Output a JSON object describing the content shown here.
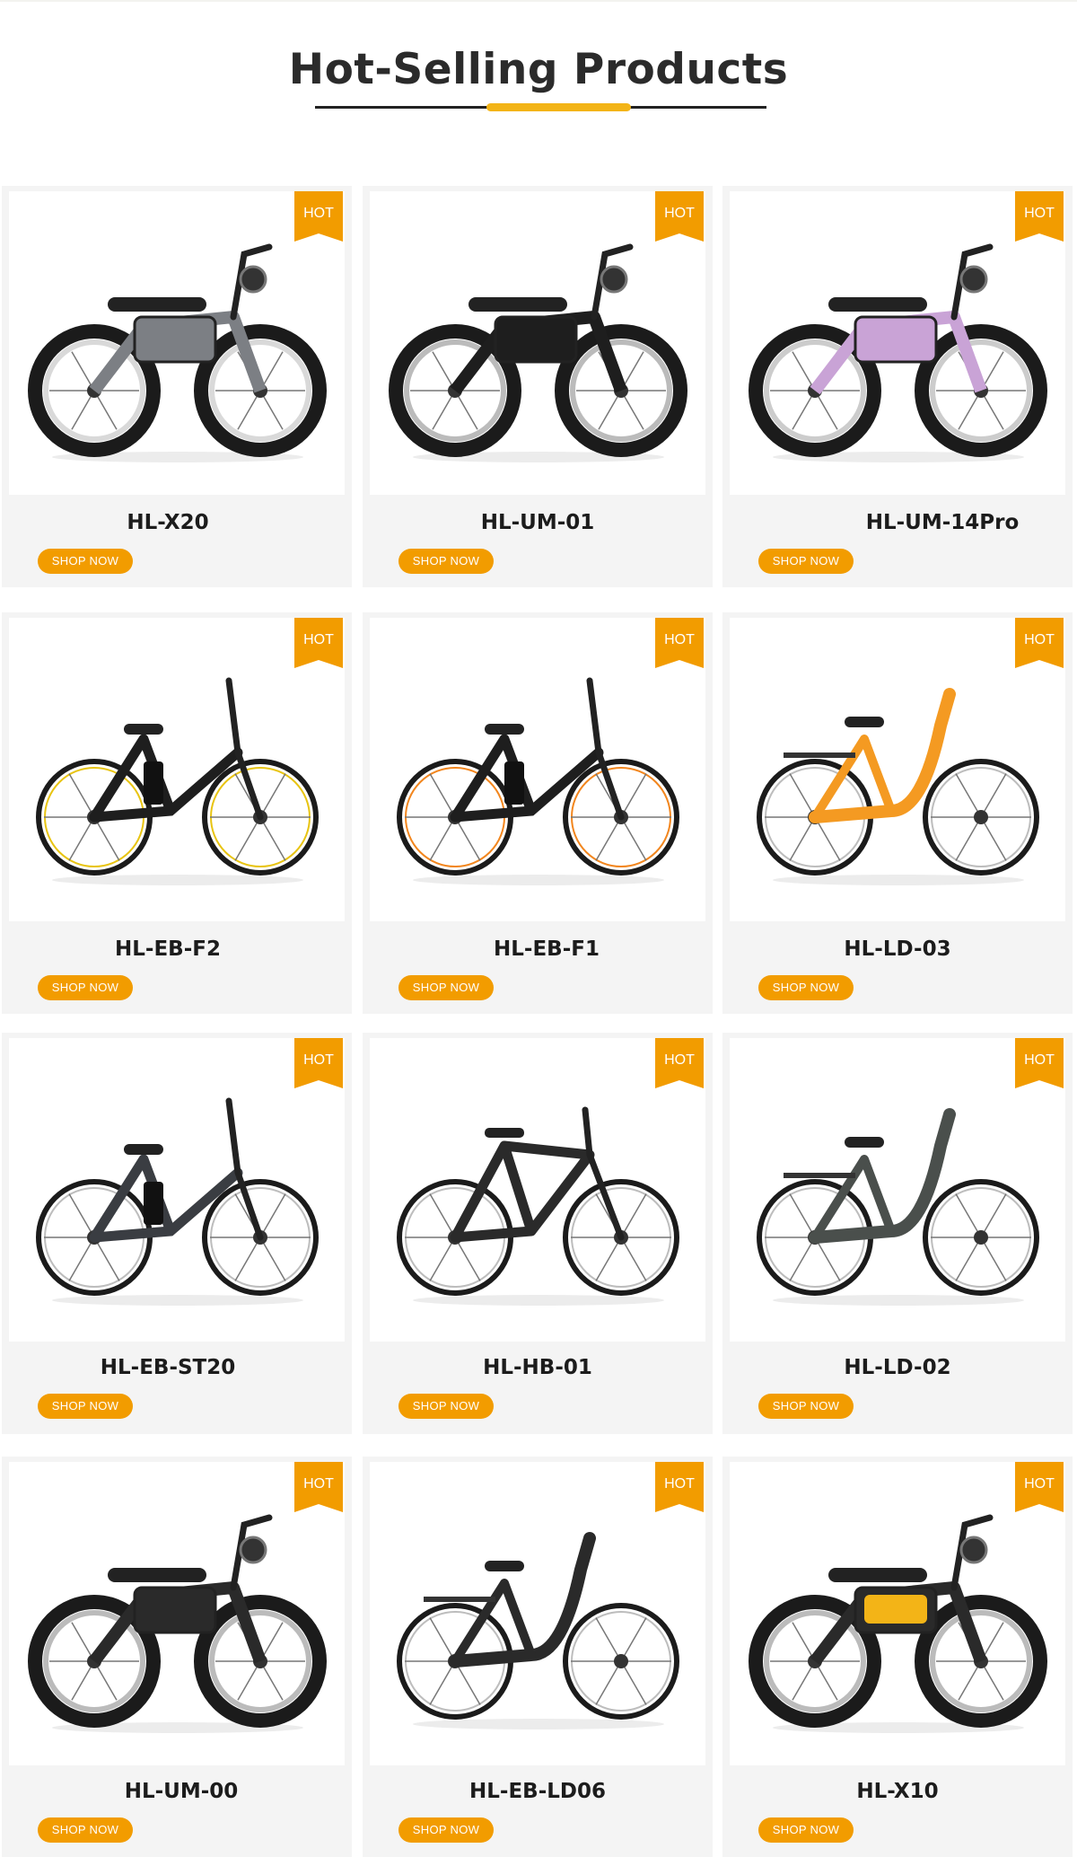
{
  "section_title": "Hot-Selling Products",
  "badge_label": "HOT",
  "button_label": "SHOP NOW",
  "colors": {
    "accent": "#f29c00",
    "title_bar": "#f3b417",
    "card_bg": "#f4f4f4"
  },
  "products": [
    {
      "name": "HL-X20",
      "frame": "#7c7f84",
      "wheel": "#d9d9d9",
      "style": "moto"
    },
    {
      "name": "HL-UM-01",
      "frame": "#1e1e1e",
      "wheel": "#bbbbbb",
      "style": "moto"
    },
    {
      "name": "HL-UM-14Pro",
      "frame": "#c9a3d6",
      "wheel": "#cccccc",
      "style": "moto"
    },
    {
      "name": "HL-EB-F2",
      "frame": "#1e1e1e",
      "wheel": "#e8c412",
      "style": "folding"
    },
    {
      "name": "HL-EB-F1",
      "frame": "#1e1e1e",
      "wheel": "#f2861e",
      "style": "folding"
    },
    {
      "name": "HL-LD-03",
      "frame": "#f49a22",
      "wheel": "#bdbdbd",
      "style": "stepthrough"
    },
    {
      "name": "HL-EB-ST20",
      "frame": "#3a3d42",
      "wheel": "#bdbdbd",
      "style": "folding"
    },
    {
      "name": "HL-HB-01",
      "frame": "#2a2a2a",
      "wheel": "#bdbdbd",
      "style": "mountain"
    },
    {
      "name": "HL-LD-02",
      "frame": "#4a4f4c",
      "wheel": "#bdbdbd",
      "style": "stepthrough"
    },
    {
      "name": "HL-UM-00",
      "frame": "#2a2a2a",
      "wheel": "#bbbbbb",
      "style": "moto"
    },
    {
      "name": "HL-EB-LD06",
      "frame": "#2a2a2a",
      "wheel": "#bdbdbd",
      "style": "stepthrough"
    },
    {
      "name": "HL-X10",
      "frame": "#2a2a2a",
      "wheel": "#bbbbbb",
      "style": "dirt",
      "accent": "#f3b417"
    }
  ]
}
